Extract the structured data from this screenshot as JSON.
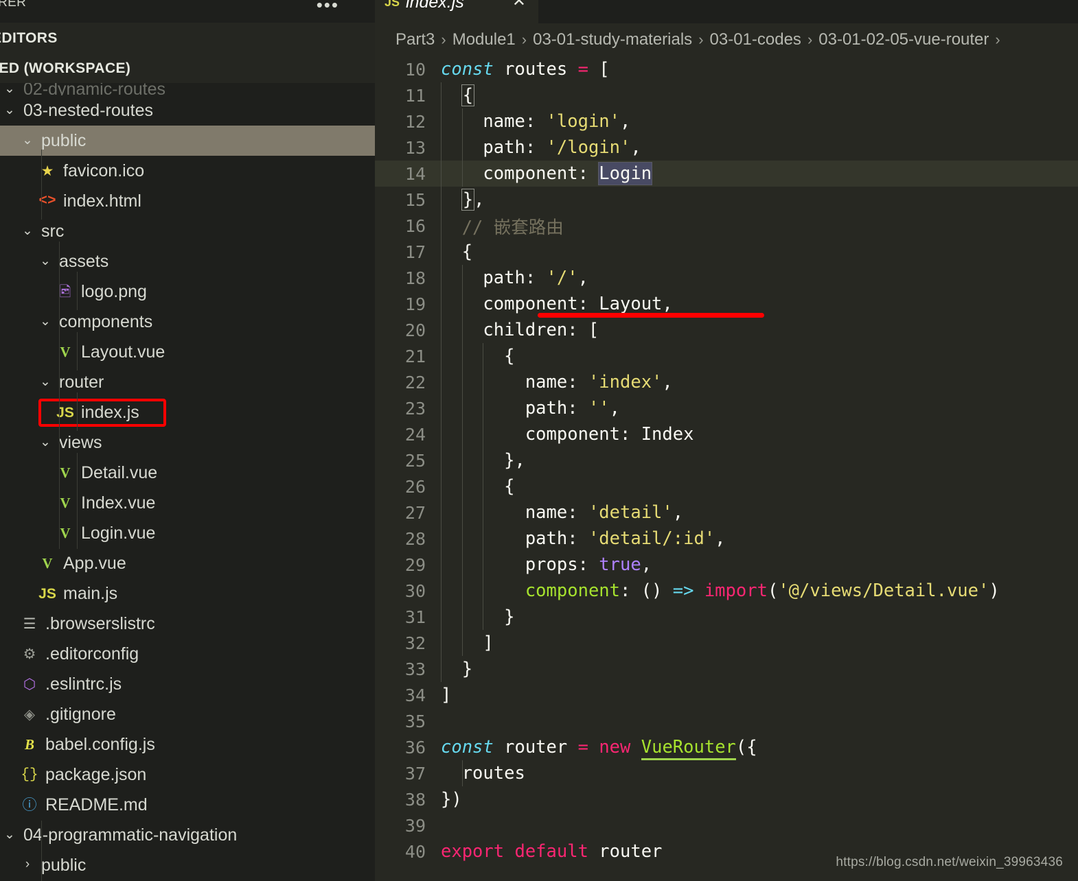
{
  "sidebar": {
    "title": "ORER",
    "dots_label": "•••",
    "open_editors_label": "EDITORS",
    "workspace_label": "TLED (WORKSPACE)",
    "partial_top_item": "02-dynamic-routes",
    "items": [
      {
        "label": "03-nested-routes",
        "icon": "chevron-down-icon",
        "kind": "folder",
        "indent": 1,
        "expanded": true
      },
      {
        "label": "public",
        "icon": "chevron-down-icon",
        "kind": "folder",
        "indent": 2,
        "expanded": true,
        "selected": true
      },
      {
        "label": "favicon.ico",
        "icon": "star-icon",
        "kind": "file",
        "indent": 3
      },
      {
        "label": "index.html",
        "icon": "html-icon",
        "kind": "file",
        "indent": 3
      },
      {
        "label": "src",
        "icon": "chevron-down-icon",
        "kind": "folder",
        "indent": 2,
        "expanded": true
      },
      {
        "label": "assets",
        "icon": "chevron-down-icon",
        "kind": "folder",
        "indent": 3,
        "expanded": true
      },
      {
        "label": "logo.png",
        "icon": "image-icon",
        "kind": "file",
        "indent": 4
      },
      {
        "label": "components",
        "icon": "chevron-down-icon",
        "kind": "folder",
        "indent": 3,
        "expanded": true
      },
      {
        "label": "Layout.vue",
        "icon": "vue-icon",
        "kind": "file",
        "indent": 4
      },
      {
        "label": "router",
        "icon": "chevron-down-icon",
        "kind": "folder",
        "indent": 3,
        "expanded": true
      },
      {
        "label": "index.js",
        "icon": "js-icon",
        "kind": "file",
        "indent": 4,
        "highlighted": true
      },
      {
        "label": "views",
        "icon": "chevron-down-icon",
        "kind": "folder",
        "indent": 3,
        "expanded": true
      },
      {
        "label": "Detail.vue",
        "icon": "vue-icon",
        "kind": "file",
        "indent": 4
      },
      {
        "label": "Index.vue",
        "icon": "vue-icon",
        "kind": "file",
        "indent": 4
      },
      {
        "label": "Login.vue",
        "icon": "vue-icon",
        "kind": "file",
        "indent": 4
      },
      {
        "label": "App.vue",
        "icon": "vue-icon",
        "kind": "file",
        "indent": 3
      },
      {
        "label": "main.js",
        "icon": "js-icon",
        "kind": "file",
        "indent": 3
      },
      {
        "label": ".browserslistrc",
        "icon": "list-icon",
        "kind": "file",
        "indent": 2
      },
      {
        "label": ".editorconfig",
        "icon": "gear-icon",
        "kind": "file",
        "indent": 2
      },
      {
        "label": ".eslintrc.js",
        "icon": "eslint-icon",
        "kind": "file",
        "indent": 2
      },
      {
        "label": ".gitignore",
        "icon": "git-icon",
        "kind": "file",
        "indent": 2
      },
      {
        "label": "babel.config.js",
        "icon": "babel-icon",
        "kind": "file",
        "indent": 2
      },
      {
        "label": "package.json",
        "icon": "json-icon",
        "kind": "file",
        "indent": 2
      },
      {
        "label": "README.md",
        "icon": "markdown-icon",
        "kind": "file",
        "indent": 2
      },
      {
        "label": "04-programmatic-navigation",
        "icon": "chevron-down-icon",
        "kind": "folder",
        "indent": 1,
        "expanded": true
      },
      {
        "label": "public",
        "icon": "chevron-right-icon",
        "kind": "folder",
        "indent": 2,
        "expanded": false
      }
    ]
  },
  "editor": {
    "tab": {
      "icon_label": "JS",
      "name": "index.js",
      "close_label": "✕"
    },
    "breadcrumbs": [
      "Part3",
      "Module1",
      "03-01-study-materials",
      "03-01-codes",
      "03-01-02-05-vue-router"
    ],
    "breadcrumb_separator": "›",
    "lines": [
      {
        "n": 10,
        "tokens": [
          {
            "t": "const ",
            "c": "t-kw"
          },
          {
            "t": "routes ",
            "c": "t-plain"
          },
          {
            "t": "= ",
            "c": "t-op"
          },
          {
            "t": "[",
            "c": "t-plain"
          }
        ],
        "indent_pre": 6
      },
      {
        "n": 11,
        "tokens": [
          {
            "t": "  ",
            "c": "t-plain"
          },
          {
            "t": "{",
            "c": "t-plain",
            "box": true
          }
        ],
        "indent_pre": 6
      },
      {
        "n": 12,
        "tokens": [
          {
            "t": "    name: ",
            "c": "t-plain"
          },
          {
            "t": "'login'",
            "c": "t-str"
          },
          {
            "t": ",",
            "c": "t-plain"
          }
        ],
        "indent_pre": 6
      },
      {
        "n": 13,
        "tokens": [
          {
            "t": "    path: ",
            "c": "t-plain"
          },
          {
            "t": "'/login'",
            "c": "t-str"
          },
          {
            "t": ",",
            "c": "t-plain"
          }
        ],
        "indent_pre": 6
      },
      {
        "n": 14,
        "tokens": [
          {
            "t": "    component: ",
            "c": "t-plain"
          },
          {
            "t": "Login",
            "c": "t-plain",
            "sel": true
          }
        ],
        "active": true,
        "indent_pre": 6
      },
      {
        "n": 15,
        "tokens": [
          {
            "t": "  ",
            "c": "t-plain"
          },
          {
            "t": "}",
            "c": "t-plain",
            "box": true
          },
          {
            "t": ",",
            "c": "t-plain"
          }
        ],
        "indent_pre": 6
      },
      {
        "n": 16,
        "tokens": [
          {
            "t": "  // 嵌套路由",
            "c": "t-cmt"
          }
        ],
        "indent_pre": 6
      },
      {
        "n": 17,
        "tokens": [
          {
            "t": "  {",
            "c": "t-plain"
          }
        ],
        "indent_pre": 6
      },
      {
        "n": 18,
        "tokens": [
          {
            "t": "    path: ",
            "c": "t-plain"
          },
          {
            "t": "'/'",
            "c": "t-str"
          },
          {
            "t": ",",
            "c": "t-plain"
          }
        ],
        "indent_pre": 6
      },
      {
        "n": 19,
        "tokens": [
          {
            "t": "    component: Layout,",
            "c": "t-plain"
          }
        ],
        "indent_pre": 6
      },
      {
        "n": 20,
        "tokens": [
          {
            "t": "    children: [",
            "c": "t-plain"
          }
        ],
        "indent_pre": 6
      },
      {
        "n": 21,
        "tokens": [
          {
            "t": "      {",
            "c": "t-plain"
          }
        ],
        "indent_pre": 6
      },
      {
        "n": 22,
        "tokens": [
          {
            "t": "        name: ",
            "c": "t-plain"
          },
          {
            "t": "'index'",
            "c": "t-str"
          },
          {
            "t": ",",
            "c": "t-plain"
          }
        ],
        "indent_pre": 6
      },
      {
        "n": 23,
        "tokens": [
          {
            "t": "        path: ",
            "c": "t-plain"
          },
          {
            "t": "''",
            "c": "t-str"
          },
          {
            "t": ",",
            "c": "t-plain"
          }
        ],
        "indent_pre": 6
      },
      {
        "n": 24,
        "tokens": [
          {
            "t": "        component: Index",
            "c": "t-plain"
          }
        ],
        "indent_pre": 6
      },
      {
        "n": 25,
        "tokens": [
          {
            "t": "      },",
            "c": "t-plain"
          }
        ],
        "indent_pre": 6
      },
      {
        "n": 26,
        "tokens": [
          {
            "t": "      {",
            "c": "t-plain"
          }
        ],
        "indent_pre": 6
      },
      {
        "n": 27,
        "tokens": [
          {
            "t": "        name: ",
            "c": "t-plain"
          },
          {
            "t": "'detail'",
            "c": "t-str"
          },
          {
            "t": ",",
            "c": "t-plain"
          }
        ],
        "indent_pre": 6
      },
      {
        "n": 28,
        "tokens": [
          {
            "t": "        path: ",
            "c": "t-plain"
          },
          {
            "t": "'detail/:id'",
            "c": "t-str"
          },
          {
            "t": ",",
            "c": "t-plain"
          }
        ],
        "indent_pre": 6
      },
      {
        "n": 29,
        "tokens": [
          {
            "t": "        props: ",
            "c": "t-plain"
          },
          {
            "t": "true",
            "c": "t-num"
          },
          {
            "t": ",",
            "c": "t-plain"
          }
        ],
        "indent_pre": 6
      },
      {
        "n": 30,
        "tokens": [
          {
            "t": "        ",
            "c": "t-plain"
          },
          {
            "t": "component",
            "c": "t-fn"
          },
          {
            "t": ": () ",
            "c": "t-plain"
          },
          {
            "t": "=> ",
            "c": "t-arrow"
          },
          {
            "t": "import",
            "c": "t-op"
          },
          {
            "t": "(",
            "c": "t-plain"
          },
          {
            "t": "'@/views/Detail.vue'",
            "c": "t-str"
          },
          {
            "t": ")",
            "c": "t-plain"
          }
        ],
        "indent_pre": 6
      },
      {
        "n": 31,
        "tokens": [
          {
            "t": "      }",
            "c": "t-plain"
          }
        ],
        "indent_pre": 6
      },
      {
        "n": 32,
        "tokens": [
          {
            "t": "    ]",
            "c": "t-plain"
          }
        ],
        "indent_pre": 6
      },
      {
        "n": 33,
        "tokens": [
          {
            "t": "  }",
            "c": "t-plain"
          }
        ],
        "indent_pre": 6
      },
      {
        "n": 34,
        "tokens": [
          {
            "t": "]",
            "c": "t-plain"
          }
        ],
        "indent_pre": 6
      },
      {
        "n": 35,
        "tokens": [],
        "indent_pre": 6
      },
      {
        "n": 36,
        "tokens": [
          {
            "t": "const ",
            "c": "t-kw"
          },
          {
            "t": "router ",
            "c": "t-plain"
          },
          {
            "t": "= ",
            "c": "t-op"
          },
          {
            "t": "new ",
            "c": "t-op"
          },
          {
            "t": "VueRouter",
            "c": "t-fn",
            "uline": true
          },
          {
            "t": "({",
            "c": "t-plain"
          }
        ],
        "indent_pre": 6
      },
      {
        "n": 37,
        "tokens": [
          {
            "t": "  routes",
            "c": "t-plain"
          }
        ],
        "indent_pre": 6
      },
      {
        "n": 38,
        "tokens": [
          {
            "t": "})",
            "c": "t-plain"
          }
        ],
        "indent_pre": 6
      },
      {
        "n": 39,
        "tokens": [],
        "indent_pre": 6
      },
      {
        "n": 40,
        "tokens": [
          {
            "t": "export default ",
            "c": "t-op"
          },
          {
            "t": "router",
            "c": "t-plain"
          }
        ],
        "indent_pre": 6
      }
    ]
  },
  "watermark": "https://blog.csdn.net/weixin_39963436",
  "colors": {
    "editor_bg": "#272822",
    "sidebar_bg": "#1e1f1c",
    "selection_row": "#807a6b",
    "annotation_red": "#ff0000",
    "active_line": "#34362b",
    "keyword": "#66d9ef",
    "string": "#e6db74",
    "operator": "#f92672",
    "function": "#a6e22e",
    "comment": "#75715e",
    "number": "#ae81ff"
  }
}
